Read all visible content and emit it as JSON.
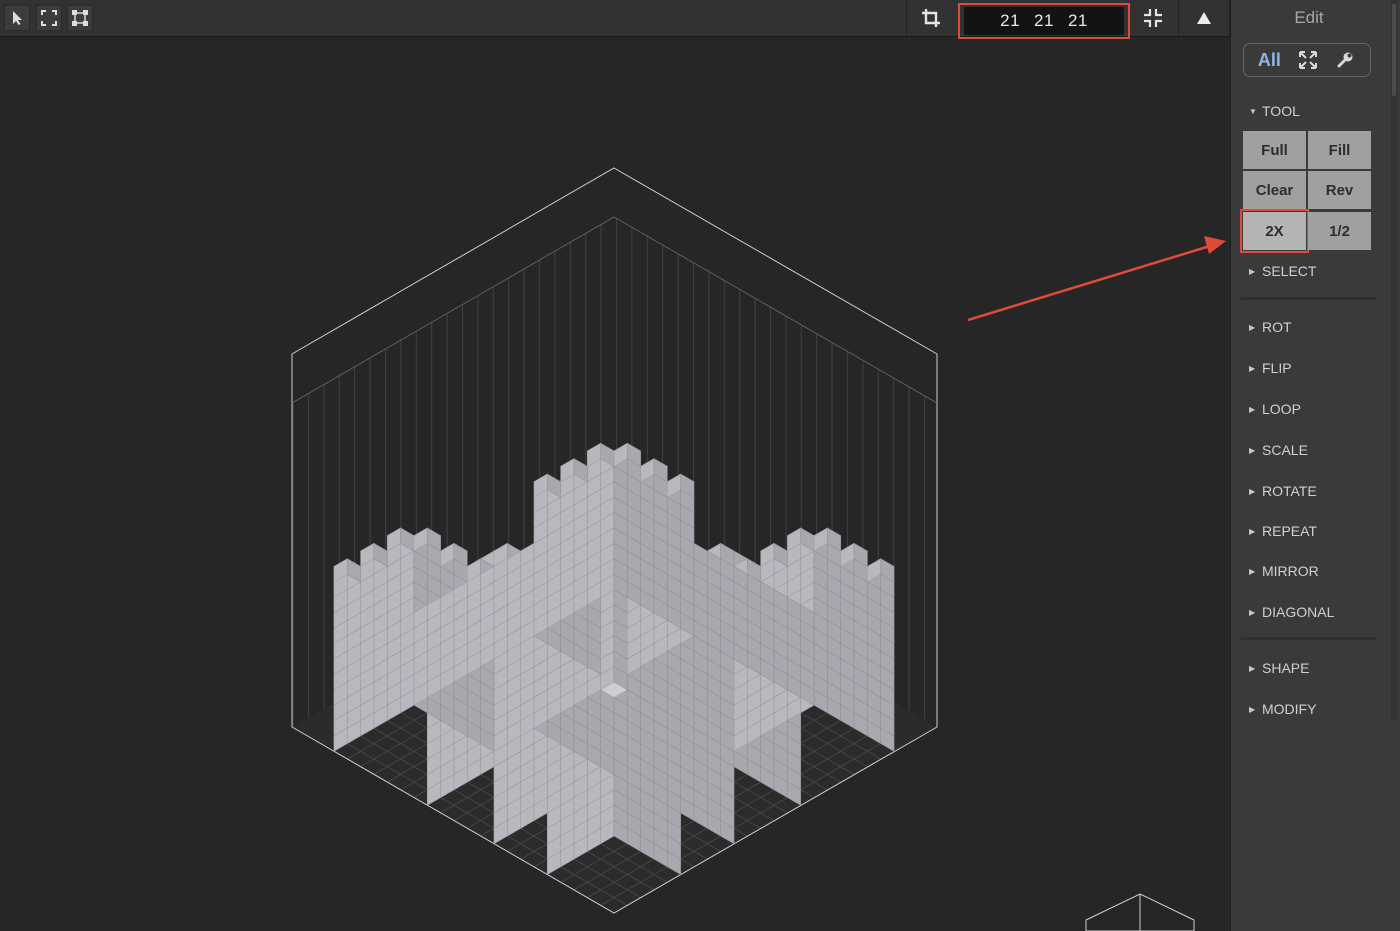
{
  "toolbar": {
    "selection_tools": [
      "select-arrow-icon",
      "box-select-icon",
      "vertex-select-icon"
    ],
    "crop_icon": "crop-icon",
    "dimensions": {
      "x": "21",
      "y": "21",
      "z": "21"
    },
    "collapse_icon": "collapse-icon",
    "up_icon": "triangle-up-icon"
  },
  "panel": {
    "title": "Edit",
    "modes": {
      "all_label": "All",
      "icons": [
        "resize-icon",
        "wrench-icon"
      ]
    },
    "tool_section": "TOOL",
    "tool_buttons": [
      "Full",
      "Fill",
      "Clear",
      "Rev",
      "2X",
      "1/2"
    ],
    "highlighted_button": "2X",
    "sections_a": [
      "SELECT"
    ],
    "sections_b": [
      "ROT",
      "FLIP",
      "LOOP",
      "SCALE",
      "ROTATE",
      "REPEAT",
      "MIRROR",
      "DIAGONAL"
    ],
    "sections_c": [
      "SHAPE",
      "MODIFY"
    ]
  },
  "colors": {
    "highlight": "#e04a3a",
    "accent_blue": "#8ab8e8",
    "voxel_top": "#cecdd4",
    "voxel_left": "#b9b8bf",
    "voxel_right": "#a5a4ab"
  }
}
